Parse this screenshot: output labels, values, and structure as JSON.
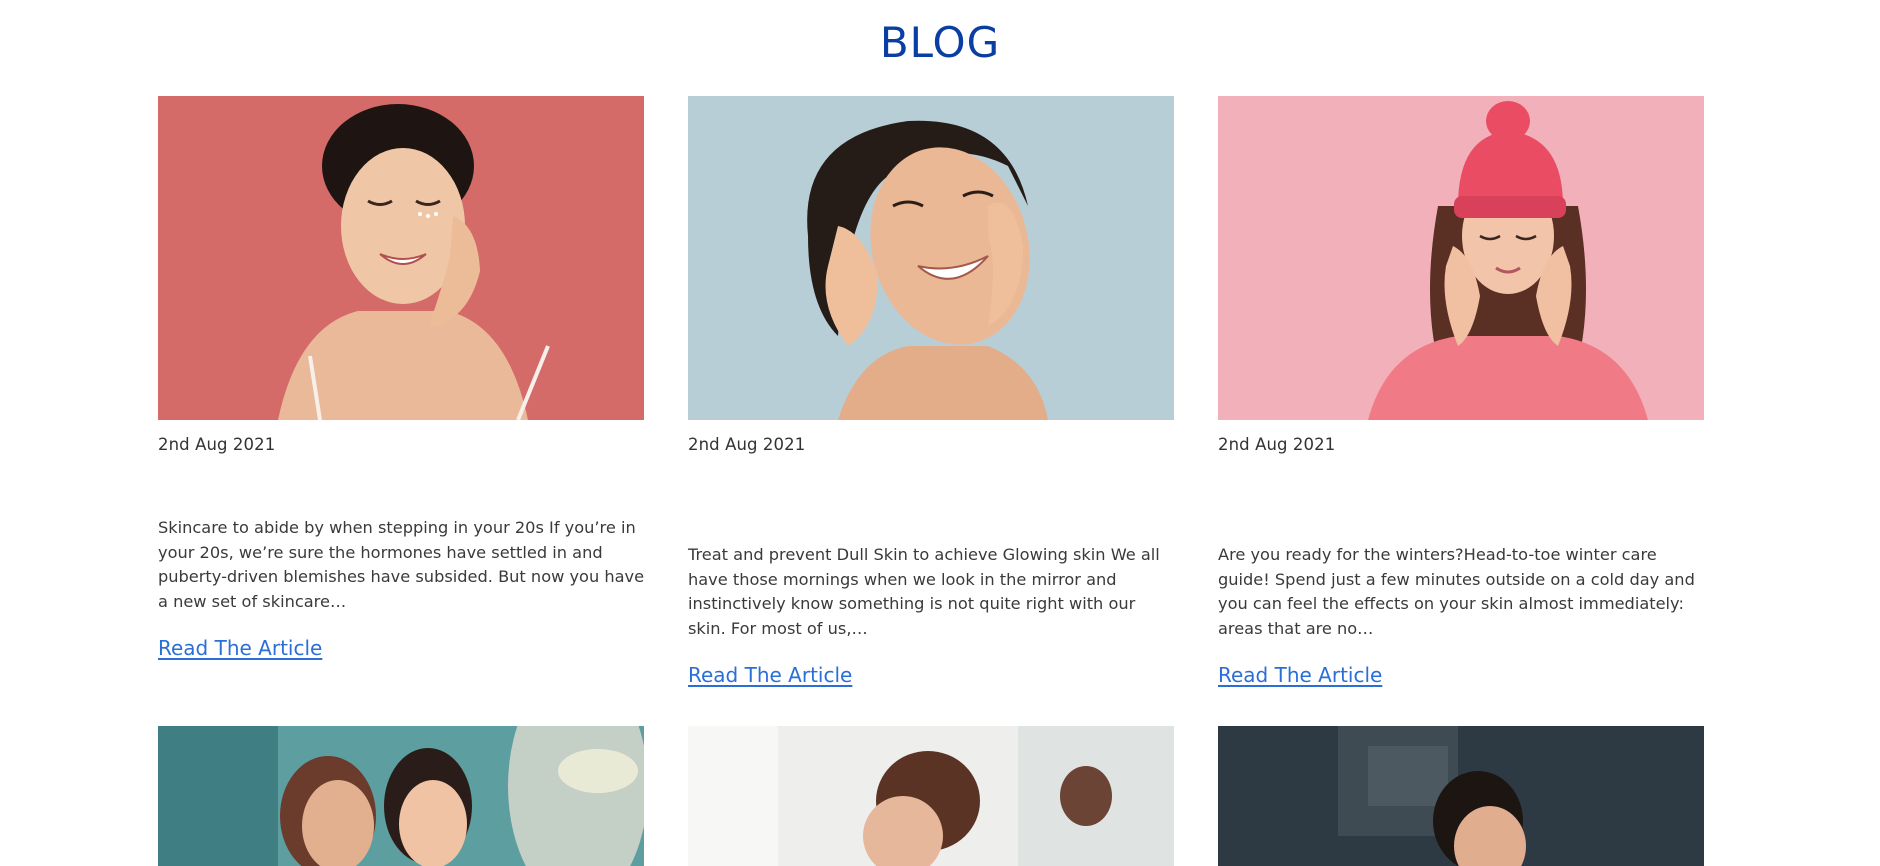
{
  "section_title": "BLOG",
  "posts": [
    {
      "date": "2nd Aug 2021",
      "excerpt": "Skincare to abide by when stepping in your 20s If you’re in your 20s, we’re sure the hormones have settled in and puberty-driven blemishes have subsided. But now you have a new set of skincare…",
      "link": "Read The Article",
      "bg_color": "#d46b68"
    },
    {
      "date": "2nd Aug 2021",
      "excerpt": "Treat and prevent Dull Skin to achieve Glowing skin We all have those mornings when we look in the mirror and instinctively know something is not quite right with our skin. For most of us,…",
      "link": "Read The Article",
      "bg_color": "#b8ced6"
    },
    {
      "date": "2nd Aug 2021",
      "excerpt": "Are you ready for the winters?Head-to-toe winter care guide! Spend just a few minutes outside on a cold day and you can feel the effects on your skin almost immediately: areas that are no…",
      "link": "Read The Article",
      "bg_color": "#f2b1ba"
    }
  ],
  "colors": {
    "title": "#0b3ea3",
    "link": "#2a6fd8",
    "text": "#3a3a3a"
  }
}
